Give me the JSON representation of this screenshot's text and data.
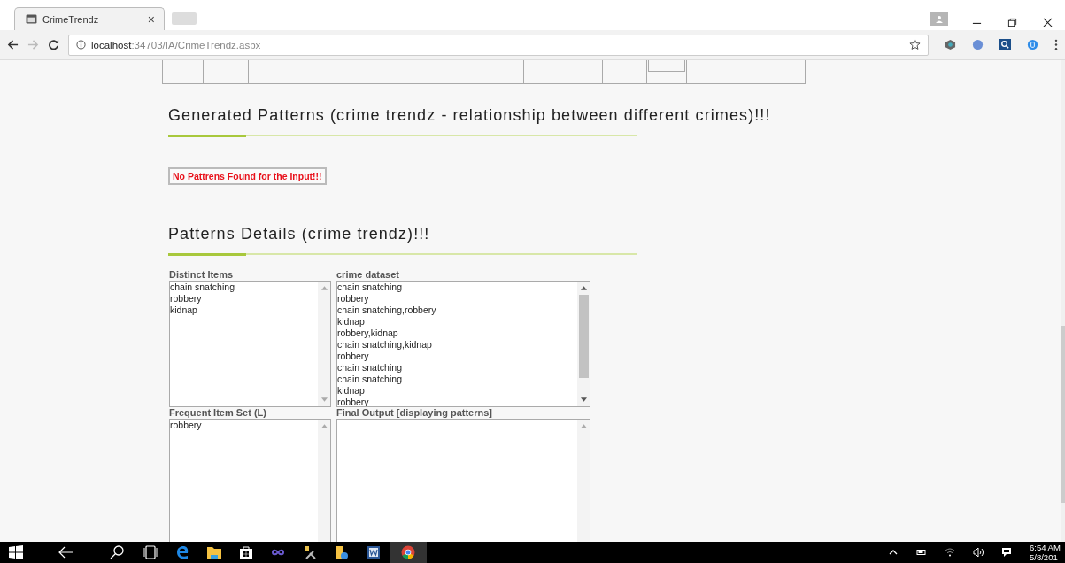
{
  "browser": {
    "tab_title": "CrimeTrendz",
    "tab_close": "×",
    "address_host": "localhost",
    "address_rest": ":34703/IA/CrimeTrendz.aspx"
  },
  "sections": [
    {
      "heading": "Generated Patterns (crime trendz - relationship between different crimes)!!!"
    },
    {
      "heading": "Patterns Details (crime trendz)!!!"
    }
  ],
  "message": "No Pattrens Found for the Input!!!",
  "lists": [
    {
      "label": "Distinct Items",
      "scrollable": false,
      "items": [
        "chain snatching",
        "robbery",
        "kidnap"
      ]
    },
    {
      "label": "crime dataset",
      "scrollable": true,
      "items": [
        "chain snatching",
        "robbery",
        "chain snatching,robbery",
        "kidnap",
        "robbery,kidnap",
        "chain snatching,kidnap",
        "robbery",
        "chain snatching",
        "chain snatching",
        "kidnap",
        "robbery"
      ]
    },
    {
      "label": "Frequent Item Set (L)",
      "scrollable": false,
      "items": [
        "robbery"
      ]
    },
    {
      "label": "Final Output [displaying patterns]",
      "scrollable": false
    }
  ],
  "taskbar": {
    "time": "6:54 AM",
    "date": "5/8/201"
  }
}
